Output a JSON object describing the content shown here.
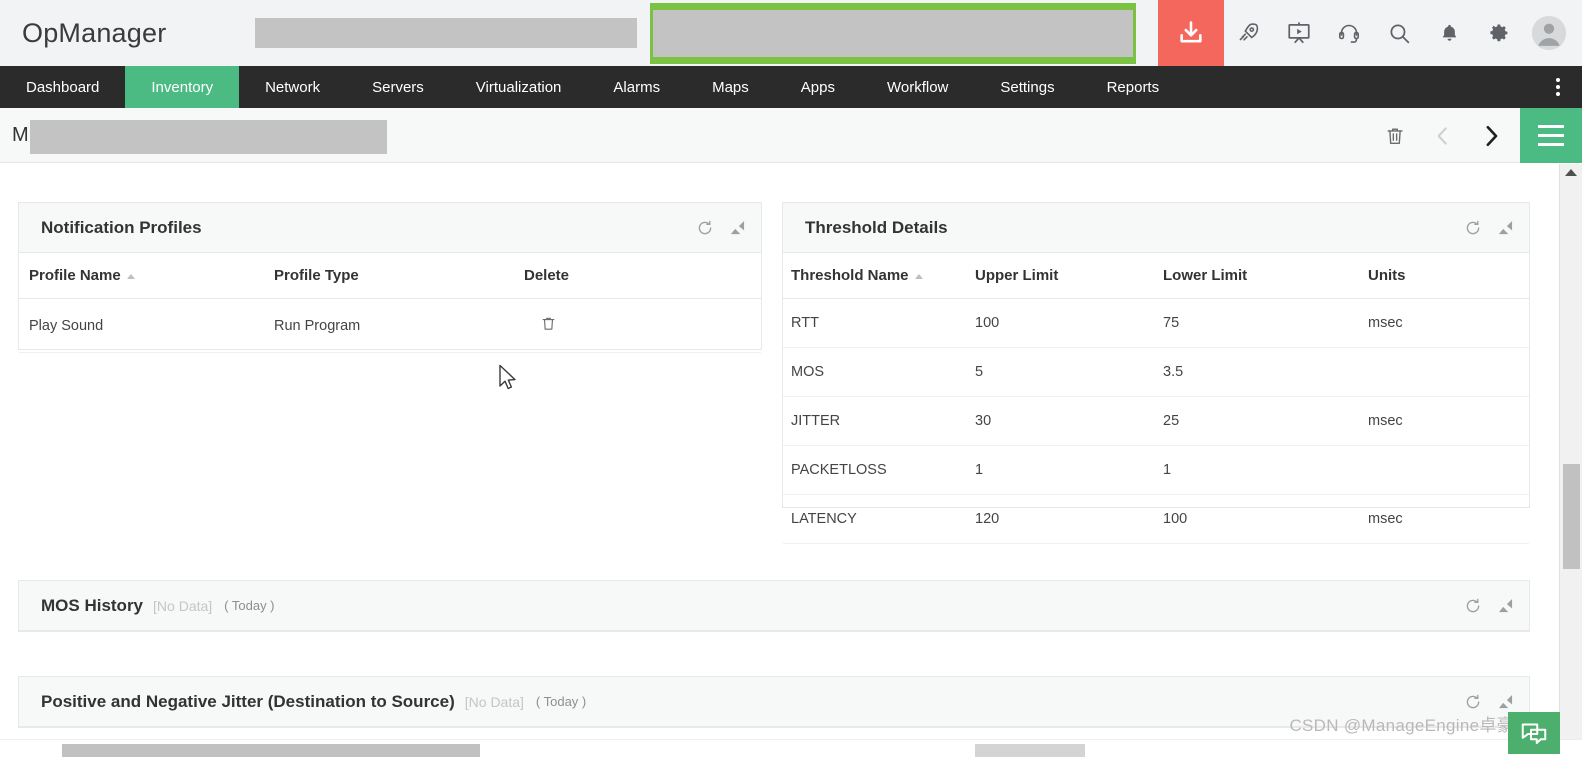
{
  "header": {
    "logo": "OpManager",
    "icons": [
      {
        "name": "download-icon",
        "label": "Download"
      },
      {
        "name": "rocket-icon",
        "label": "What's New"
      },
      {
        "name": "presentation-icon",
        "label": "Demo Videos"
      },
      {
        "name": "headset-icon",
        "label": "Support"
      },
      {
        "name": "search-icon",
        "label": "Search"
      },
      {
        "name": "bell-icon",
        "label": "Notifications"
      },
      {
        "name": "gear-icon",
        "label": "Settings"
      },
      {
        "name": "avatar-icon",
        "label": "Profile"
      }
    ]
  },
  "nav": {
    "tabs": [
      {
        "label": "Dashboard",
        "active": false
      },
      {
        "label": "Inventory",
        "active": true
      },
      {
        "label": "Network",
        "active": false
      },
      {
        "label": "Servers",
        "active": false
      },
      {
        "label": "Virtualization",
        "active": false
      },
      {
        "label": "Alarms",
        "active": false
      },
      {
        "label": "Maps",
        "active": false
      },
      {
        "label": "Apps",
        "active": false
      },
      {
        "label": "Workflow",
        "active": false
      },
      {
        "label": "Settings",
        "active": false
      },
      {
        "label": "Reports",
        "active": false
      }
    ],
    "more_label": "More"
  },
  "subheader": {
    "title": "M",
    "actions": {
      "delete": "Delete",
      "previous": "Previous",
      "next": "Next",
      "menu": "Menu"
    }
  },
  "notification_profiles": {
    "title": "Notification Profiles",
    "columns": [
      "Profile Name",
      "Profile Type",
      "Delete"
    ],
    "rows": [
      {
        "profile_name": "Play Sound",
        "profile_type": "Run Program"
      }
    ]
  },
  "threshold_details": {
    "title": "Threshold Details",
    "columns": [
      "Threshold Name",
      "Upper Limit",
      "Lower Limit",
      "Units"
    ],
    "rows": [
      {
        "name": "RTT",
        "upper": "100",
        "lower": "75",
        "units": "msec"
      },
      {
        "name": "MOS",
        "upper": "5",
        "lower": "3.5",
        "units": ""
      },
      {
        "name": "JITTER",
        "upper": "30",
        "lower": "25",
        "units": "msec"
      },
      {
        "name": "PACKETLOSS",
        "upper": "1",
        "lower": "1",
        "units": ""
      },
      {
        "name": "LATENCY",
        "upper": "120",
        "lower": "100",
        "units": "msec"
      }
    ]
  },
  "mos_history": {
    "title": "MOS History",
    "no_data": "[No Data]",
    "period": "( Today )"
  },
  "jitter_panel": {
    "title": "Positive and Negative Jitter (Destination to Source)",
    "no_data": "[No Data]",
    "period": "( Today )"
  },
  "watermark": {
    "text": "CSDN @ManageEngine卓豪"
  },
  "colors": {
    "accent_green": "#4cbb83",
    "brand_green": "#7cc242",
    "download_red": "#f4675c",
    "nav_dark": "#2b2b2b",
    "panel_header": "#f7f8f8"
  }
}
